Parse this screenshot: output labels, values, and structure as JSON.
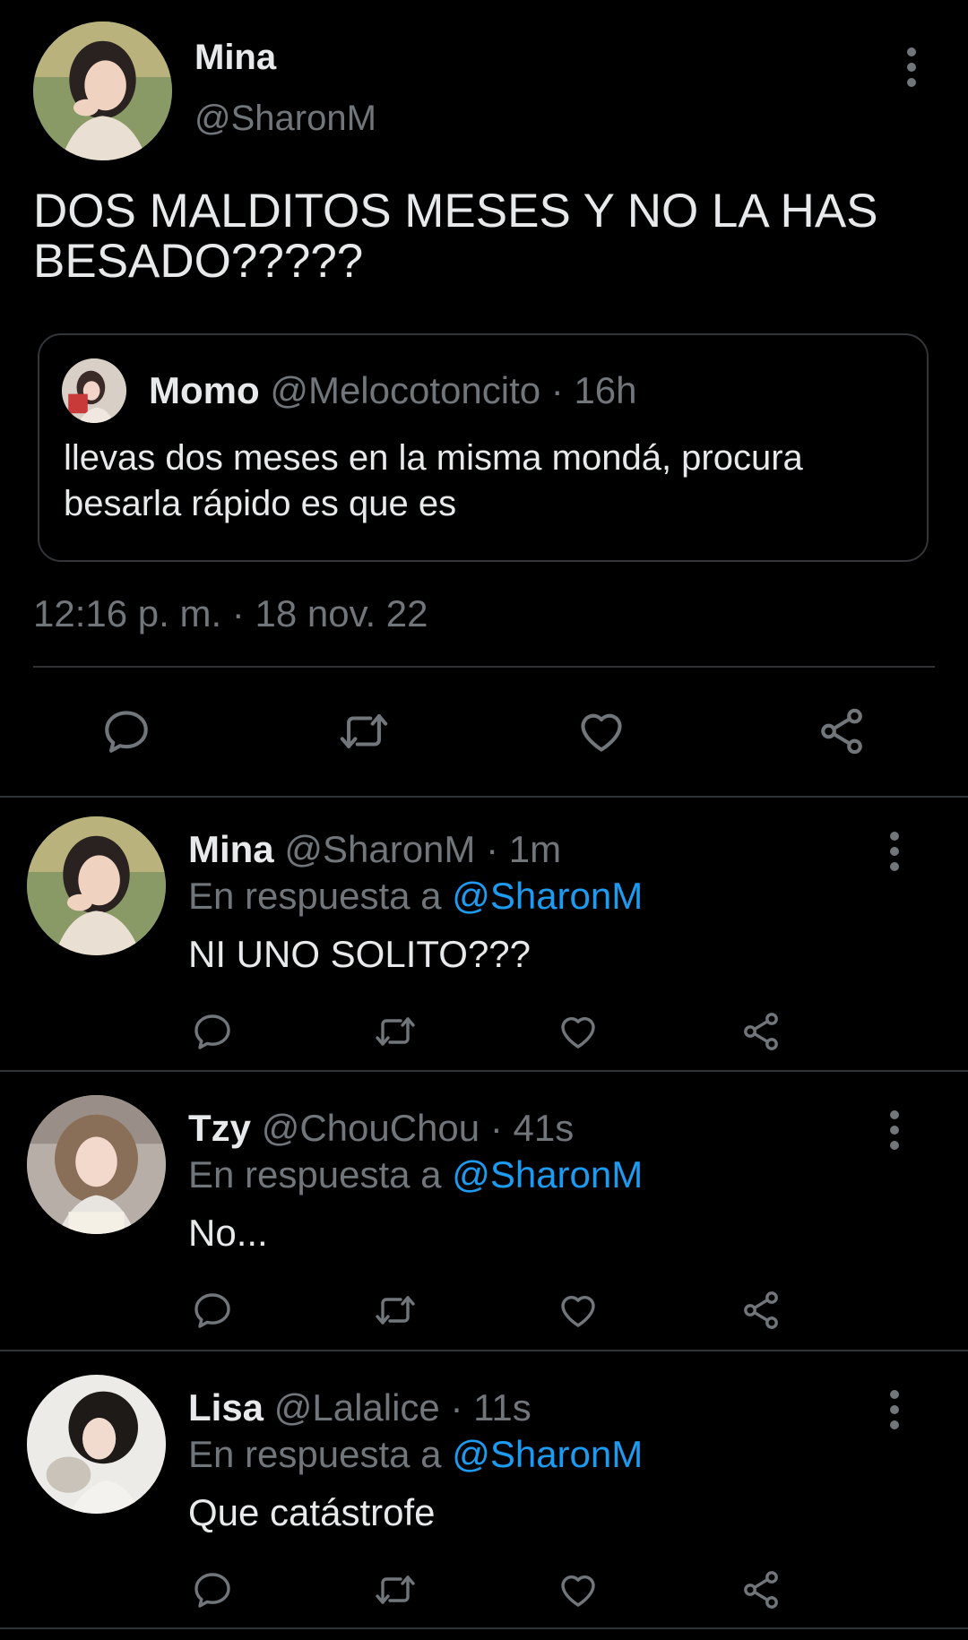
{
  "colors": {
    "background": "#000000",
    "text": "#e7e9ea",
    "muted": "#71767b",
    "link": "#1d9bf0",
    "divider": "#2f3336"
  },
  "main_tweet": {
    "name": "Mina",
    "handle": "@SharonM",
    "text": "DOS MALDITOS MESES Y NO LA HAS\nBESADO?????",
    "quote": {
      "name": "Momo",
      "handle": "@Melocotoncito",
      "dot": "·",
      "time": "16h",
      "text": "llevas dos meses en la misma mondá, procura besarla rápido es que es"
    },
    "time": "12:16 p. m.",
    "dot": "·",
    "date": "18 nov. 22",
    "actions": [
      "reply-icon",
      "retweet-icon",
      "like-icon",
      "share-icon"
    ]
  },
  "replies": [
    {
      "name": "Mina",
      "handle": "@SharonM",
      "dot": "·",
      "time": "1m",
      "in_reply_prefix": "En respuesta a",
      "in_reply_handle": "@SharonM",
      "text": "NI UNO SOLITO???"
    },
    {
      "name": "Tzy",
      "handle": "@ChouChou",
      "dot": "·",
      "time": "41s",
      "in_reply_prefix": "En respuesta a",
      "in_reply_handle": "@SharonM",
      "text": "No..."
    },
    {
      "name": "Lisa",
      "handle": "@Lalalice",
      "dot": "·",
      "time": "11s",
      "in_reply_prefix": "En respuesta a",
      "in_reply_handle": "@SharonM",
      "text": "Que catástrofe"
    }
  ]
}
